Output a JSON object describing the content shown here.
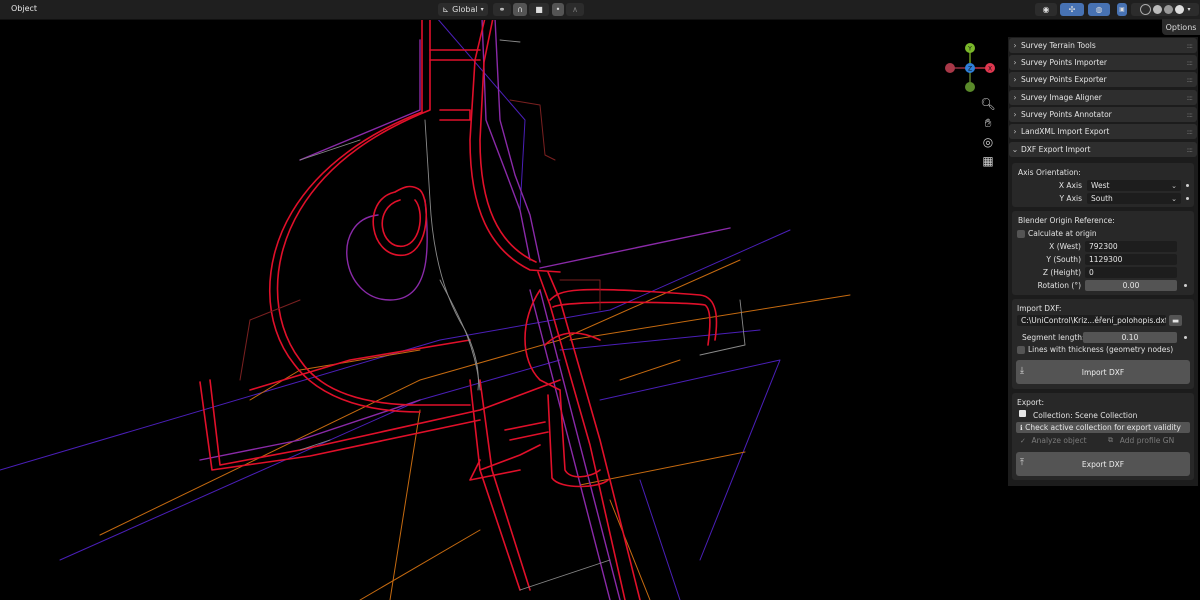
{
  "header": {
    "mode_label": "Object",
    "orientation_label": "Global",
    "options_label": "Options"
  },
  "gizmo": {
    "y": "Y",
    "x": "X",
    "z": "Z"
  },
  "sidebar": {
    "panels": [
      {
        "label": "Survey Terrain Tools"
      },
      {
        "label": "Survey Points Importer"
      },
      {
        "label": "Survey Points Exporter"
      },
      {
        "label": "Survey Image Aligner"
      },
      {
        "label": "Survey Points Annotator"
      },
      {
        "label": "LandXML Import Export"
      }
    ],
    "dxf": {
      "title": "DXF Export Import",
      "axis_orientation_label": "Axis Orientation:",
      "x_axis_label": "X Axis",
      "x_axis_value": "West",
      "y_axis_label": "Y Axis",
      "y_axis_value": "South",
      "origin_ref_label": "Blender Origin Reference:",
      "calc_origin_label": "Calculate at origin",
      "x_west_label": "X (West)",
      "x_west_value": "792300",
      "y_south_label": "Y (South)",
      "y_south_value": "1129300",
      "z_height_label": "Z (Height)",
      "z_height_value": "0",
      "rotation_label": "Rotation (°)",
      "rotation_value": "0.00",
      "import_label": "Import DXF:",
      "file_path": "C:\\UniControl\\Kriz...ěření_polohopis.dxf",
      "segment_label": "Segment length:",
      "segment_value": "0.10",
      "thickness_label": "Lines with thickness (geometry nodes)",
      "import_button": "Import DXF",
      "export_label": "Export:",
      "collection_label": "Collection: Scene Collection",
      "check_button": "Check active collection for export validity",
      "analyze_button": "Analyze object",
      "add_profile_button": "Add profile GN",
      "export_button": "Export DXF"
    }
  },
  "colors": {
    "background": "#000000",
    "red": "#e0102a",
    "purple": "#8a2aa8",
    "violet": "#4a1fb8",
    "orange": "#c56a10",
    "gray": "#8a8a8a",
    "panel": "#1c1c1c",
    "accent": "#4772b3"
  }
}
